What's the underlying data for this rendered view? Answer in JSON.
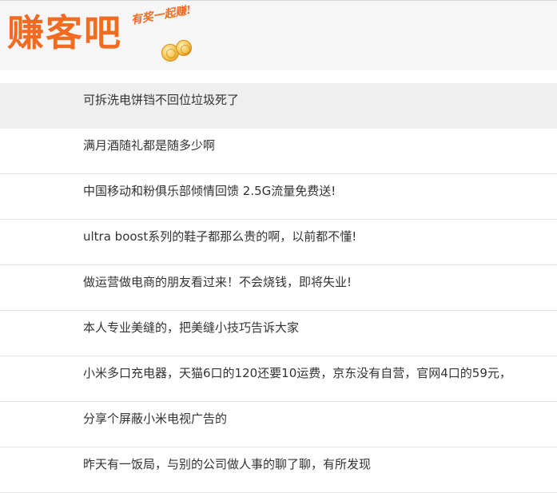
{
  "site": {
    "logo_text": "赚客吧",
    "tagline": "有奖一起赚!",
    "logo_icon": "gold-coins-icon"
  },
  "colors": {
    "brand": "#f26b21",
    "text": "#333333",
    "highlight_bg": "#efefef",
    "divider": "#e6e6e6",
    "header_bg": "#f6f6f6"
  },
  "threads": [
    {
      "title": "可拆洗电饼铛不回位垃圾死了",
      "highlighted": true
    },
    {
      "title": "满月酒随礼都是随多少啊"
    },
    {
      "title": "中国移动和粉俱乐部倾情回馈 2.5G流量免费送!"
    },
    {
      "title": "ultra boost系列的鞋子都那么贵的啊，以前都不懂!"
    },
    {
      "title": "做运营做电商的朋友看过来！不会烧钱，即将失业!"
    },
    {
      "title": "本人专业美缝的，把美缝小技巧告诉大家"
    },
    {
      "title": "小米多口充电器，天猫6口的120还要10运费，京东没有自营，官网4口的59元，"
    },
    {
      "title": "分享个屏蔽小米电视广告的"
    },
    {
      "title": "昨天有一饭局，与别的公司做人事的聊了聊，有所发现"
    }
  ]
}
